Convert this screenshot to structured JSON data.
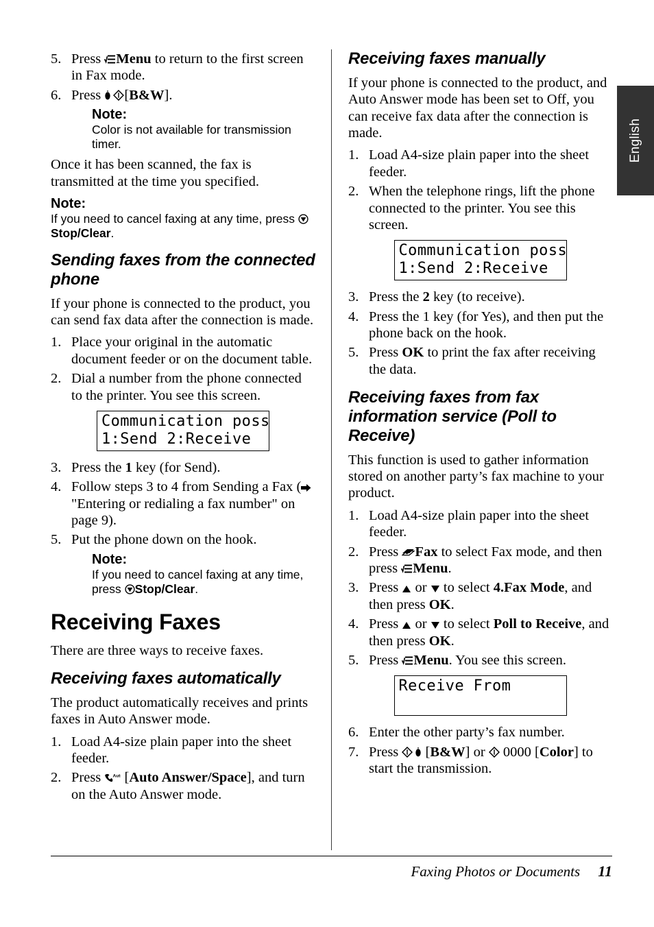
{
  "document": {
    "language_tab": "English",
    "footer": {
      "section_title": "Faxing Photos or Documents",
      "page_number": "11"
    }
  },
  "left_column": {
    "step5": {
      "num": "5.",
      "t1": "Press ",
      "icon": "menu-icon",
      "bold": "Menu",
      "t2": " to return to the first screen in Fax mode."
    },
    "step6": {
      "num": "6.",
      "t1": "Press ",
      "icon_drop": "ink-drop-icon",
      "icon_start": "start-diamond-icon",
      "bracket_open": "[",
      "bold": "B&W",
      "bracket_close": "]."
    },
    "note1": {
      "title": "Note:",
      "body": "Color is not available for transmission timer."
    },
    "para_once": "Once it has been scanned, the fax is transmitted at the time you specified.",
    "note2": {
      "title": "Note:",
      "body_1": "If you need to cancel faxing at any time, press ",
      "icon": "stop-clear-icon",
      "bold": "Stop/Clear",
      "body_2": "."
    },
    "heading_sending": "Sending faxes from the connected phone",
    "para_if_phone": "If your phone is connected to the product, you can send fax data after the connection is made.",
    "steps": [
      {
        "num": "1.",
        "text": "Place your original in the automatic document feeder or on the document table."
      },
      {
        "num": "2.",
        "text": "Dial a number from the phone connected to the printer. You see this screen."
      }
    ],
    "lcd1": {
      "line1": "Communication poss",
      "line2": "1:Send 2:Receive"
    },
    "step3": {
      "num": "3.",
      "t1": "Press the ",
      "bold": "1",
      "t2": " key (for Send)."
    },
    "step4": {
      "num": "4.",
      "t1": "Follow steps 3 to 4 from Sending a Fax (",
      "icon": "arrow-right-icon",
      "t2": " \"Entering or redialing a fax number\" on page 9)."
    },
    "step5b": {
      "num": "5.",
      "text": "Put the phone down on the hook."
    },
    "note3": {
      "title": "Note:",
      "body_1": "If you need to cancel faxing at any time, press ",
      "icon": "stop-clear-icon",
      "bold": "Stop/Clear",
      "body_2": "."
    },
    "heading_receiving": "Receiving Faxes",
    "para_three_ways": "There are three ways to receive faxes.",
    "heading_auto": "Receiving faxes automatically",
    "para_auto": "The product automatically receives and prints faxes in Auto Answer mode.",
    "steps_auto": [
      {
        "num": "1.",
        "text": "Load A4-size plain paper into the sheet feeder."
      }
    ],
    "step_auto2": {
      "num": "2.",
      "t1": "Press ",
      "icon": "auto-answer-phone-icon",
      "t2": " [",
      "bold": "Auto Answer/Space",
      "t3": "], and turn on the Auto Answer mode."
    }
  },
  "right_column": {
    "heading_manual": "Receiving faxes manually",
    "para_manual": "If your phone is connected to the product, and Auto Answer mode has been set to Off, you can receive fax data after the connection is made.",
    "steps_manual": [
      {
        "num": "1.",
        "text": "Load A4-size plain paper into the sheet feeder."
      },
      {
        "num": "2.",
        "text": "When the telephone rings, lift the phone connected to the printer. You see this screen."
      }
    ],
    "lcd2": {
      "line1": "Communication poss",
      "line2": "1:Send 2:Receive"
    },
    "step3": {
      "num": "3.",
      "t1": "Press the ",
      "bold": "2",
      "t2": " key (to receive)."
    },
    "step4": {
      "num": "4.",
      "text": "Press the 1 key (for Yes), and then put the phone back on the hook."
    },
    "step5": {
      "num": "5.",
      "t1": "Press ",
      "bold": "OK",
      "t2": " to print the fax after receiving the data."
    },
    "heading_poll": "Receiving faxes from fax information service (Poll to Receive)",
    "para_poll": "This function is used to gather information stored on another party’s fax machine to your product.",
    "steps_poll_1": {
      "num": "1.",
      "text": "Load A4-size plain paper into the sheet feeder."
    },
    "steps_poll_2": {
      "num": "2.",
      "t1": "Press ",
      "icon_fax": "fax-mode-icon",
      "bold1": "Fax",
      "t2": " to select Fax mode, and then press ",
      "icon_menu": "menu-icon",
      "bold2": "Menu",
      "t3": "."
    },
    "steps_poll_3": {
      "num": "3.",
      "t1": "Press ",
      "icon_up": "arrow-up-icon",
      "t2": " or ",
      "icon_down": "arrow-down-icon",
      "t3": " to select ",
      "bold1": "4.Fax Mode",
      "t4": ", and then press ",
      "bold2": "OK",
      "t5": "."
    },
    "steps_poll_4": {
      "num": "4.",
      "t1": "Press ",
      "icon_up": "arrow-up-icon",
      "t2": " or ",
      "icon_down": "arrow-down-icon",
      "t3": " to select ",
      "bold1": "Poll to Receive",
      "t4": ", and then press ",
      "bold2": "OK",
      "t5": "."
    },
    "steps_poll_5": {
      "num": "5.",
      "t1": "Press ",
      "icon_menu": "menu-icon",
      "bold": "Menu",
      "t2": ". You see this screen."
    },
    "lcd3": {
      "line1": "Receive From",
      "line2": " "
    },
    "steps_poll_6": {
      "num": "6.",
      "text": "Enter the other party’s fax number."
    },
    "steps_poll_7": {
      "num": "7.",
      "t1": "Press ",
      "icon_start": "start-diamond-icon",
      "icon_drop": "ink-drop-icon",
      "t2": " [",
      "bold1": "B&W",
      "t3": "] or ",
      "icon_start2": "start-diamond-icon",
      "t4": " 0000 [",
      "bold2": "Color",
      "t5": "] to start the transmission."
    }
  }
}
